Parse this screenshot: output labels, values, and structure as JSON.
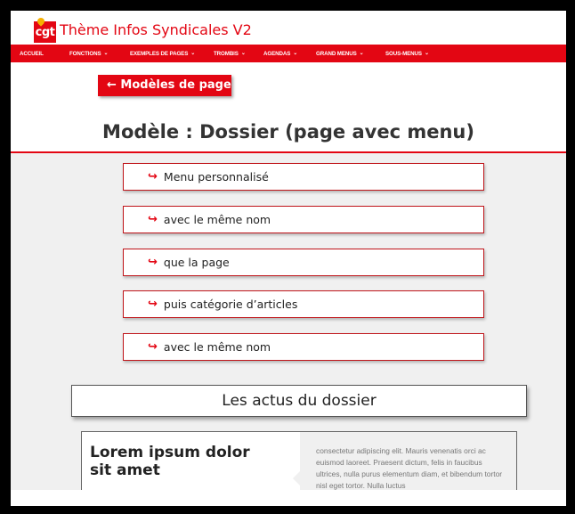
{
  "site": {
    "logo_text": "cgt",
    "title": "Thème Infos Syndicales V2",
    "brand_color": "#e30613"
  },
  "nav": {
    "items": [
      {
        "label": "ACCUEIL",
        "has_dropdown": false
      },
      {
        "label": "FONCTIONS",
        "has_dropdown": true
      },
      {
        "label": "EXEMPLES DE PAGES",
        "has_dropdown": true
      },
      {
        "label": "TROMBIS",
        "has_dropdown": true
      },
      {
        "label": "AGENDAS",
        "has_dropdown": true
      },
      {
        "label": "GRAND MENUS",
        "has_dropdown": true
      },
      {
        "label": "SOUS-MENUS",
        "has_dropdown": true
      }
    ],
    "chevron": "⌄"
  },
  "page": {
    "back_button": "← Modèles de page",
    "title": "Modèle : Dossier (page avec menu)"
  },
  "menu": {
    "arrow_icon": "redo-arrow-icon",
    "arrow_glyph": "↪",
    "items": [
      {
        "label": "Menu personnalisé"
      },
      {
        "label": "avec le même nom"
      },
      {
        "label": "que la page"
      },
      {
        "label": "puis catégorie d’articles"
      },
      {
        "label": "avec le même nom"
      }
    ]
  },
  "section": {
    "heading": "Les actus du dossier"
  },
  "article": {
    "title": "Lorem ipsum dolor sit amet",
    "excerpt": "consectetur adipiscing elit. Mauris venenatis orci ac euismod laoreet.  Praesent dictum, felis in faucibus ultrices, nulla purus elementum diam, et bibendum tortor nisl eget tortor. Nulla luctus"
  }
}
